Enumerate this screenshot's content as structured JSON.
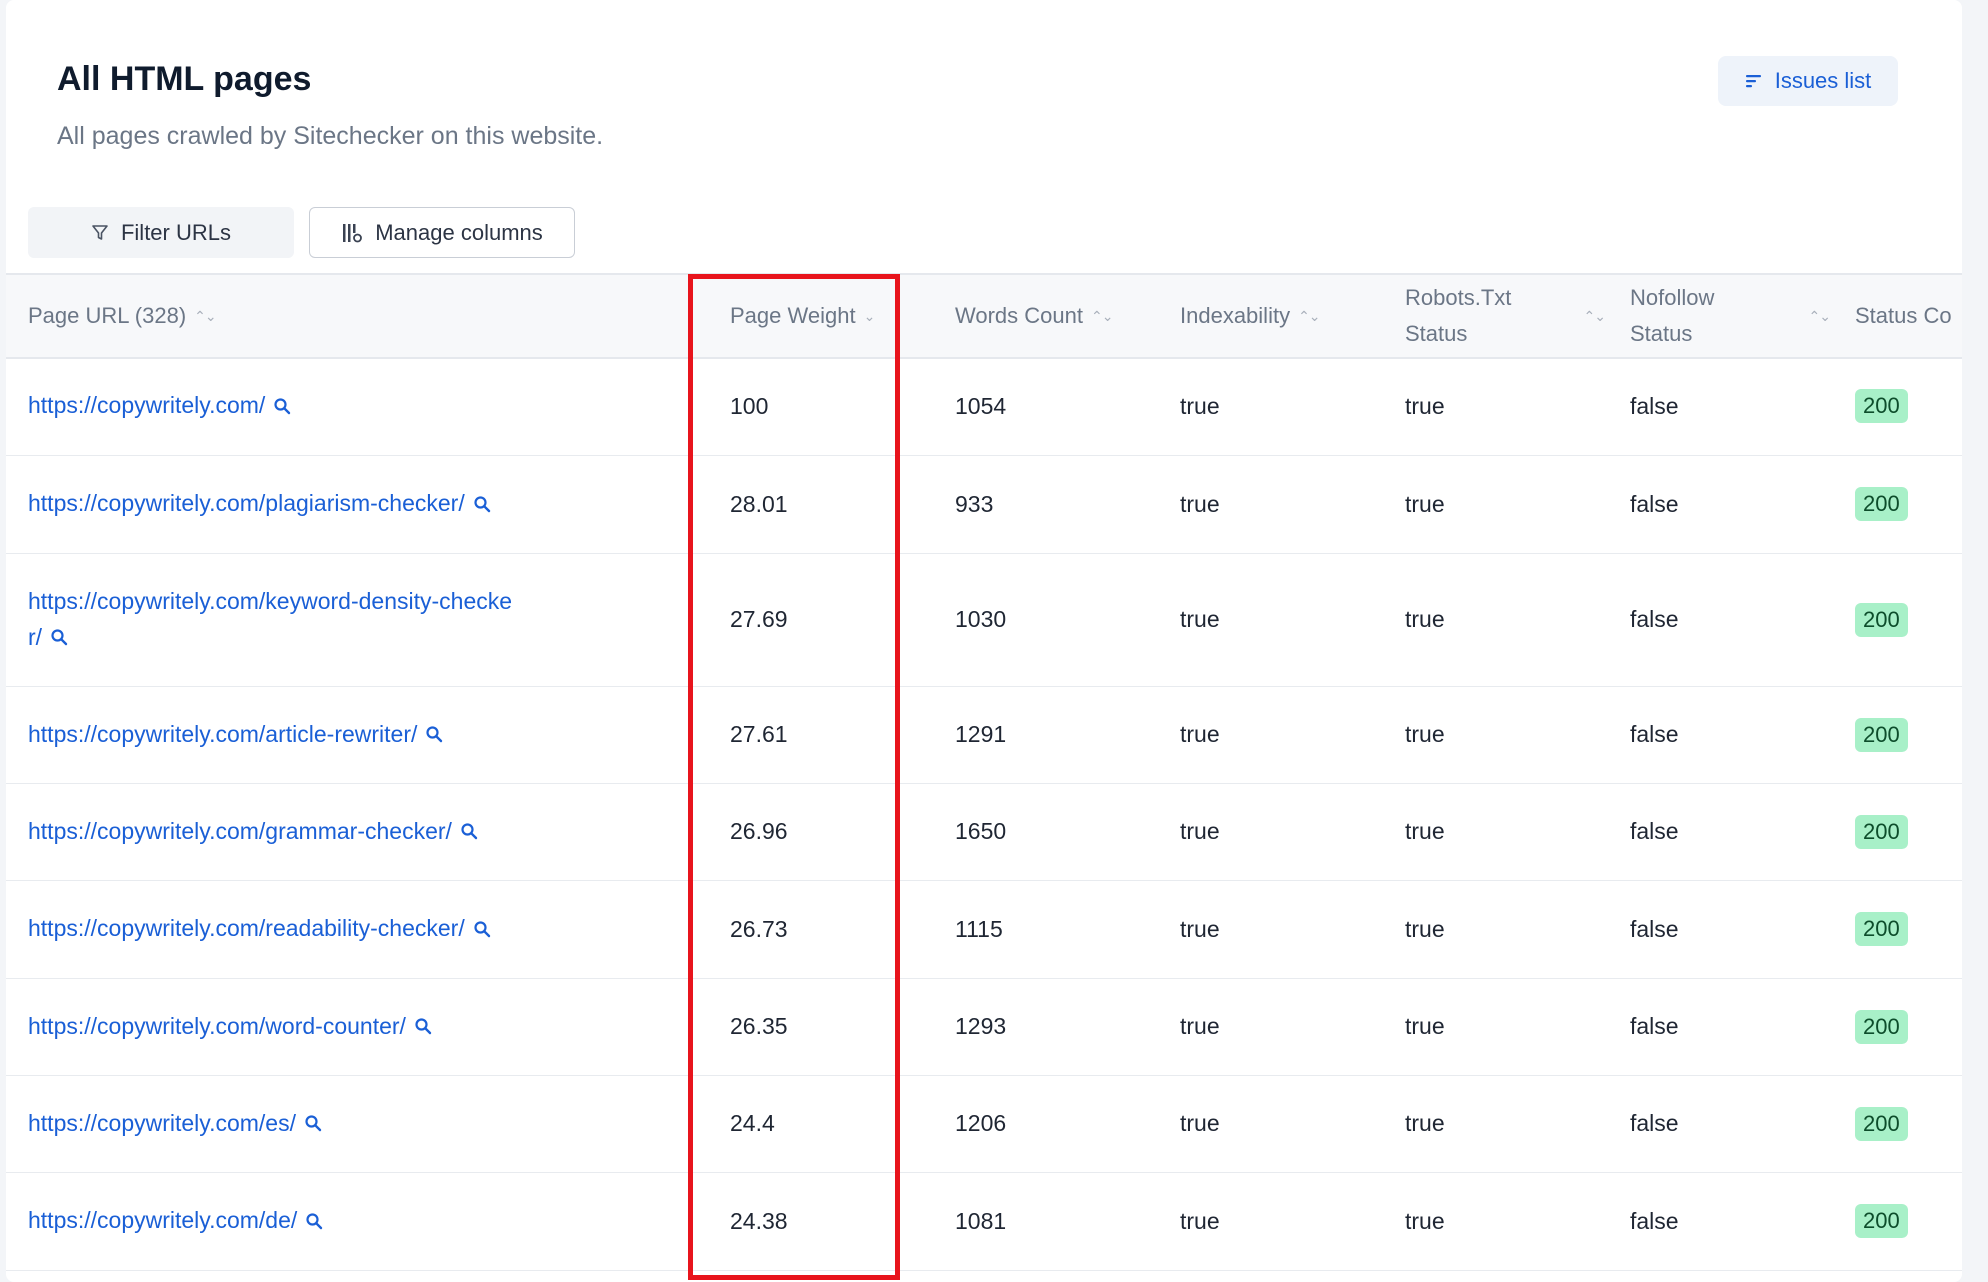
{
  "header": {
    "title": "All HTML pages",
    "subtitle": "All pages crawled by Sitechecker on this website.",
    "issues_button": "Issues list"
  },
  "toolbar": {
    "filter_label": "Filter URLs",
    "manage_label": "Manage columns"
  },
  "table": {
    "columns": {
      "url": "Page URL (328)",
      "weight": "Page Weight",
      "words": "Words Count",
      "indexability": "Indexability",
      "robots_line1": "Robots.Txt",
      "robots_line2": "Status",
      "nofollow_line1": "Nofollow",
      "nofollow_line2": "Status",
      "status_code": "Status Co"
    },
    "rows": [
      {
        "url": "https://copywritely.com/",
        "weight": "100",
        "words": "1054",
        "indexability": "true",
        "robots": "true",
        "nofollow": "false",
        "status": "200"
      },
      {
        "url": "https://copywritely.com/plagiarism-checker/",
        "weight": "28.01",
        "words": "933",
        "indexability": "true",
        "robots": "true",
        "nofollow": "false",
        "status": "200"
      },
      {
        "url_line1": "https://copywritely.com/keyword-density-checke",
        "url_line2": "r/",
        "weight": "27.69",
        "words": "1030",
        "indexability": "true",
        "robots": "true",
        "nofollow": "false",
        "status": "200"
      },
      {
        "url": "https://copywritely.com/article-rewriter/",
        "weight": "27.61",
        "words": "1291",
        "indexability": "true",
        "robots": "true",
        "nofollow": "false",
        "status": "200"
      },
      {
        "url": "https://copywritely.com/grammar-checker/",
        "weight": "26.96",
        "words": "1650",
        "indexability": "true",
        "robots": "true",
        "nofollow": "false",
        "status": "200"
      },
      {
        "url": "https://copywritely.com/readability-checker/",
        "weight": "26.73",
        "words": "1115",
        "indexability": "true",
        "robots": "true",
        "nofollow": "false",
        "status": "200"
      },
      {
        "url": "https://copywritely.com/word-counter/",
        "weight": "26.35",
        "words": "1293",
        "indexability": "true",
        "robots": "true",
        "nofollow": "false",
        "status": "200"
      },
      {
        "url": "https://copywritely.com/es/",
        "weight": "24.4",
        "words": "1206",
        "indexability": "true",
        "robots": "true",
        "nofollow": "false",
        "status": "200"
      },
      {
        "url": "https://copywritely.com/de/",
        "weight": "24.38",
        "words": "1081",
        "indexability": "true",
        "robots": "true",
        "nofollow": "false",
        "status": "200"
      }
    ]
  },
  "colors": {
    "link": "#1a5fd6",
    "badge_bg": "#a8f0c8",
    "highlight": "#e8141c"
  }
}
